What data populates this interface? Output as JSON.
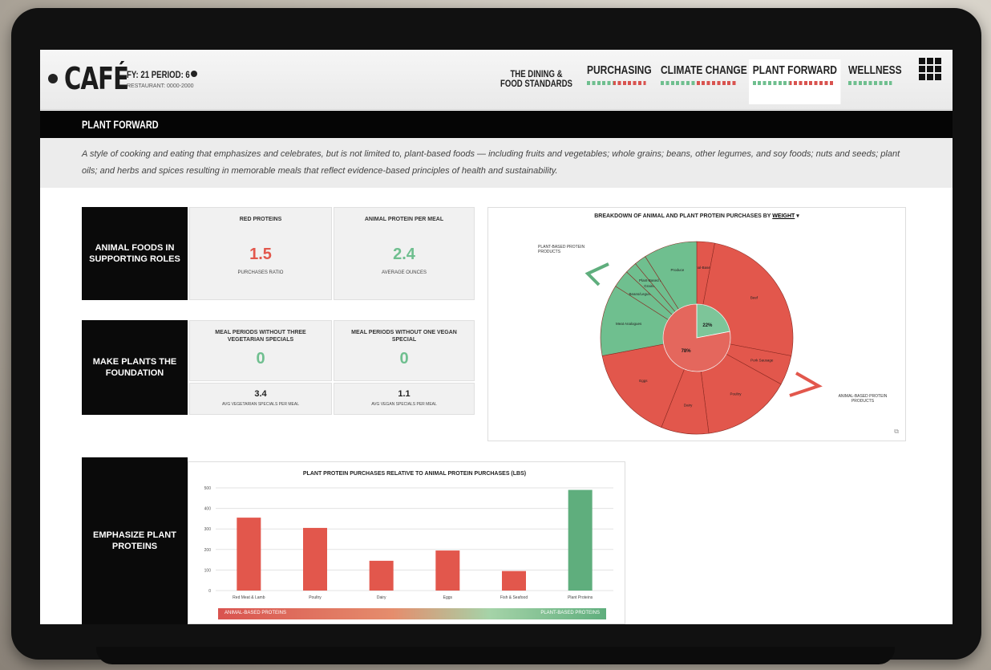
{
  "app": {
    "logo": "CAFÉ",
    "meta_line1": "FY: 21  PERIOD: 6",
    "meta_line2": "RESTAURANT: 0000-2000"
  },
  "nav": {
    "items": [
      {
        "label": "THE DINING &\nFOOD STANDARDS"
      },
      {
        "label": "PURCHASING"
      },
      {
        "label": "CLIMATE CHANGE"
      },
      {
        "label": "PLANT FORWARD"
      },
      {
        "label": "WELLNESS"
      }
    ],
    "active": "PLANT FORWARD",
    "menu_icon": "grid-icon"
  },
  "section": {
    "title": "PLANT FORWARD",
    "description": "A style of cooking and eating that emphasizes and celebrates, but is not limited to, plant-based foods — including fruits and vegetables; whole grains; beans, other legumes, and soy foods; nuts and seeds; plant oils; and herbs and spices resulting in memorable meals that reflect evidence-based principles of health and sustainability."
  },
  "blocks": {
    "animal_foods": {
      "label": "ANIMAL FOODS IN SUPPORTING ROLES",
      "card1": {
        "title": "RED PROTEINS",
        "value": "1.5",
        "caption": "PURCHASES RATIO"
      },
      "card2": {
        "title": "ANIMAL PROTEIN PER MEAL",
        "value": "2.4",
        "caption": "AVERAGE OUNCES"
      }
    },
    "plants_foundation": {
      "label": "MAKE PLANTS THE FOUNDATION",
      "card1": {
        "title": "MEAL PERIODS WITHOUT THREE VEGETARIAN SPECIALS",
        "value": "0",
        "sub_value": "3.4",
        "sub_caption": "AVG VEGETARIAN SPECIALS PER MEAL"
      },
      "card2": {
        "title": "MEAL PERIODS WITHOUT ONE VEGAN SPECIAL",
        "value": "0",
        "sub_value": "1.1",
        "sub_caption": "AVG VEGAN SPECIALS PER MEAL"
      }
    },
    "plant_proteins": {
      "label": "EMPHASIZE PLANT PROTEINS"
    }
  },
  "pie": {
    "title_prefix": "BREAKDOWN OF ANIMAL AND PLANT PROTEIN PURCHASES BY",
    "title_link": "WEIGHT",
    "inner": [
      {
        "label": "22%",
        "value": 22,
        "color": "#6fbf8f"
      },
      {
        "label": "78%",
        "value": 78,
        "color": "#e2574c"
      }
    ],
    "outer": [
      {
        "label": "Other Animal-Based Proteins",
        "value": 3,
        "color": "#e2574c"
      },
      {
        "label": "Beef",
        "value": 25,
        "color": "#e2574c"
      },
      {
        "label": "Pork Sausage",
        "value": 5,
        "color": "#e2574c"
      },
      {
        "label": "Poultry",
        "value": 15,
        "color": "#e2574c"
      },
      {
        "label": "Dairy",
        "value": 8,
        "color": "#e2574c"
      },
      {
        "label": "Eggs",
        "value": 16,
        "color": "#e2574c"
      },
      {
        "label": "Meat Analogues",
        "value": 12,
        "color": "#6fbf8f"
      },
      {
        "label": "Beans/Legumes",
        "value": 3,
        "color": "#6fbf8f"
      },
      {
        "label": "Grains",
        "value": 2,
        "color": "#6fbf8f"
      },
      {
        "label": "Plant-Based Proteins",
        "value": 2,
        "color": "#6fbf8f"
      },
      {
        "label": "Produce",
        "value": 9,
        "color": "#6fbf8f"
      }
    ],
    "callout_left": "PLANT-BASED PROTEIN PRODUCTS",
    "callout_right": "ANIMAL-BASED PROTEIN PRODUCTS"
  },
  "chart_data": {
    "type": "bar",
    "title": "PLANT PROTEIN PURCHASES RELATIVE TO ANIMAL PROTEIN PURCHASES (LBS)",
    "categories": [
      "Red Meat & Lamb",
      "Poultry",
      "Dairy",
      "Eggs",
      "Fish & Seafood",
      "Plant Proteins"
    ],
    "values": [
      355,
      305,
      145,
      195,
      95,
      490
    ],
    "colors": [
      "#e2574c",
      "#e2574c",
      "#e2574c",
      "#e2574c",
      "#e2574c",
      "#5fae7d"
    ],
    "ylim": [
      0,
      500
    ],
    "yticks": [
      0,
      100,
      200,
      300,
      400,
      500
    ],
    "grid": true
  },
  "footer": {
    "left_label": "ANIMAL-BASED PROTEINS",
    "right_label": "PLANT-BASED PROTEINS"
  }
}
